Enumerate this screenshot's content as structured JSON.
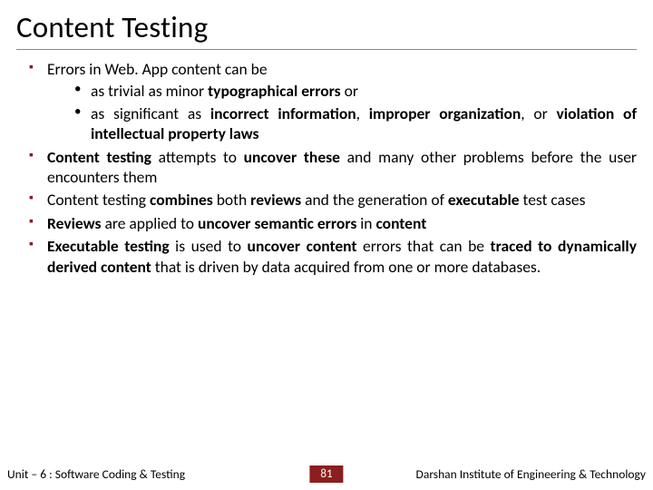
{
  "title": "Content Testing",
  "bullets": {
    "b1_lead": "Errors in Web. App content can be",
    "b1_sub1_pre": "as trivial as minor ",
    "b1_sub1_bold": "typographical errors",
    "b1_sub1_post": " or",
    "b1_sub2_pre": "as significant as ",
    "b1_sub2_b1": "incorrect information",
    "b1_sub2_mid1": ", ",
    "b1_sub2_b2": "improper organization",
    "b1_sub2_mid2": ", or ",
    "b1_sub2_b3": "violation of intellectual property laws",
    "b2_b1": "Content testing",
    "b2_mid": " attempts to ",
    "b2_b2": "uncover these",
    "b2_post": " and many other problems before the user encounters them",
    "b3_pre": "Content testing ",
    "b3_b1": "combines",
    "b3_mid1": " both ",
    "b3_b2": "reviews",
    "b3_mid2": " and the generation of ",
    "b3_b3": "executable",
    "b3_post": " test cases",
    "b4_b1": "Reviews",
    "b4_mid1": " are applied to ",
    "b4_b2": "uncover semantic errors",
    "b4_mid2": " in ",
    "b4_b3": "content",
    "b5_b1": "Executable testing",
    "b5_mid1": " is used to ",
    "b5_b2": "uncover content",
    "b5_mid2": " errors that can be ",
    "b5_b3": "traced to dynamically derived content",
    "b5_post": " that is driven by data acquired from one or more databases."
  },
  "footer": {
    "unit": "Unit – 6 : Software Coding & Testing",
    "page": "81",
    "institute": "Darshan Institute of Engineering & Technology"
  }
}
